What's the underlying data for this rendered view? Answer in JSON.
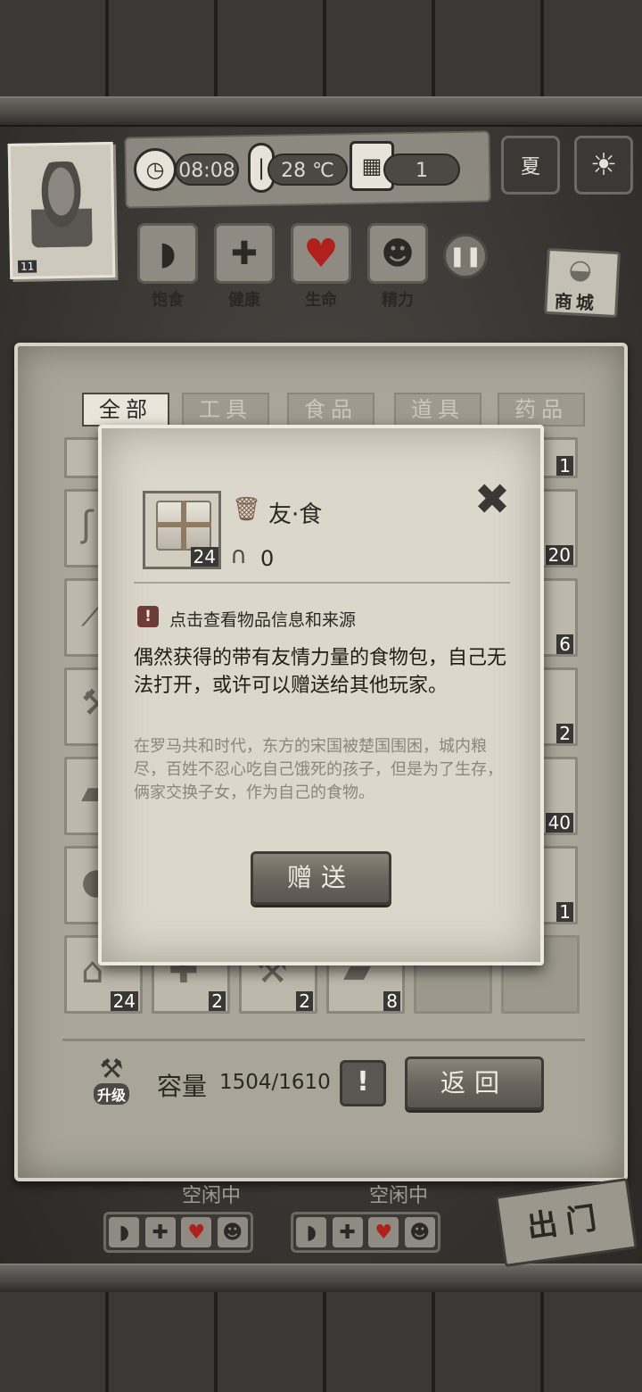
{
  "hud": {
    "time": "08:08",
    "temperature": "28 ℃",
    "day": "1",
    "level": "11",
    "season": "夏",
    "stats": [
      {
        "label": "饱食",
        "icon": "stomach-icon"
      },
      {
        "label": "健康",
        "icon": "plus-icon"
      },
      {
        "label": "生命",
        "icon": "heart-icon",
        "value": "100%"
      },
      {
        "label": "精力",
        "icon": "person-icon"
      }
    ],
    "shop_label": "商城"
  },
  "tabs": [
    {
      "label": "全部",
      "active": true
    },
    {
      "label": "工具",
      "active": false
    },
    {
      "label": "食品",
      "active": false
    },
    {
      "label": "道具",
      "active": false
    },
    {
      "label": "药品",
      "active": false
    }
  ],
  "grid_counts": {
    "r0c5": "1",
    "r1c5": "20",
    "r2c5": "6",
    "r3c5": "2",
    "r4c5": "40",
    "r5c5": "1",
    "r6c0": "24",
    "r6c1": "2",
    "r6c2": "2",
    "r6c3": "8"
  },
  "footer": {
    "upgrade_label": "升级",
    "capacity_label": "容量",
    "capacity_value": "1504/1610",
    "warn_label": "!",
    "back_label": "返回"
  },
  "below": {
    "idle_1": "空闲中",
    "idle_2": "空闲中",
    "exit_label": "出门"
  },
  "modal": {
    "item_name": "友·食",
    "item_count": "24",
    "item_qty": "0",
    "info_text": "点击查看物品信息和来源",
    "description": "偶然获得的带有友情力量的食物包，自己无法打开，或许可以赠送给其他玩家。",
    "lore": "在罗马共和时代，东方的宋国被楚国围困，城内粮尽，百姓不忍心吃自己饿死的孩子，但是为了生存，俩家交换子女，作为自己的食物。",
    "gift_label": "赠送",
    "close_label": "✖"
  }
}
